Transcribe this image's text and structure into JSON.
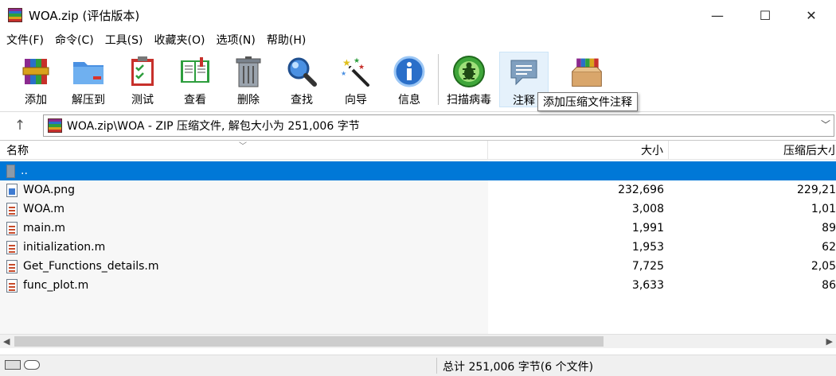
{
  "window": {
    "title": "WOA.zip (评估版本)",
    "minimize": "—",
    "maximize": "☐",
    "close": "✕"
  },
  "menu": [
    "文件(F)",
    "命令(C)",
    "工具(S)",
    "收藏夹(O)",
    "选项(N)",
    "帮助(H)"
  ],
  "toolbar": {
    "add": "添加",
    "extract": "解压到",
    "test": "测试",
    "view": "查看",
    "delete": "删除",
    "find": "查找",
    "wizard": "向导",
    "info": "信息",
    "scan": "扫描病毒",
    "comment": "注释",
    "sfx": ""
  },
  "tooltip": "添加压缩文件注释",
  "address": {
    "path": "WOA.zip\\WOA - ZIP 压缩文件, 解包大小为 251,006 字节"
  },
  "columns": {
    "name": "名称",
    "size": "大小",
    "packed": "压缩后大小"
  },
  "files": [
    {
      "name": "..",
      "size": "",
      "packed": "",
      "type": "up"
    },
    {
      "name": "WOA.png",
      "size": "232,696",
      "packed": "229,21",
      "type": "png"
    },
    {
      "name": "WOA.m",
      "size": "3,008",
      "packed": "1,01",
      "type": "m"
    },
    {
      "name": "main.m",
      "size": "1,991",
      "packed": "89",
      "type": "m"
    },
    {
      "name": "initialization.m",
      "size": "1,953",
      "packed": "62",
      "type": "m"
    },
    {
      "name": "Get_Functions_details.m",
      "size": "7,725",
      "packed": "2,05",
      "type": "m"
    },
    {
      "name": "func_plot.m",
      "size": "3,633",
      "packed": "86",
      "type": "m"
    }
  ],
  "status": {
    "summary": "总计 251,006 字节(6 个文件)"
  },
  "colors": {
    "selection": "#0078d7",
    "hover": "#e5f1fb"
  }
}
